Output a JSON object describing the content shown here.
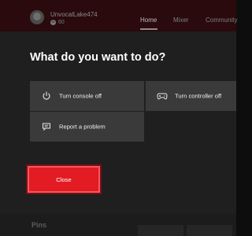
{
  "profile": {
    "gamertag": "UnvocalLake474",
    "gamerscore": "60",
    "gamerscore_glyph": "G"
  },
  "nav": {
    "tabs": [
      {
        "label": "Home",
        "active": true
      },
      {
        "label": "Mixer",
        "active": false
      },
      {
        "label": "Community",
        "active": false
      }
    ]
  },
  "dialog": {
    "title": "What do you want to do?",
    "options": [
      {
        "label": "Turn console off",
        "icon": "power-icon"
      },
      {
        "label": "Turn controller off",
        "icon": "controller-icon"
      },
      {
        "label": "Report a problem",
        "icon": "feedback-icon"
      }
    ],
    "close_label": "Close"
  },
  "bottom": {
    "pins_label": "Pins"
  },
  "colors": {
    "accent": "#e31b23",
    "tile": "#3a3a3a",
    "overlay": "#1f1f1f"
  }
}
